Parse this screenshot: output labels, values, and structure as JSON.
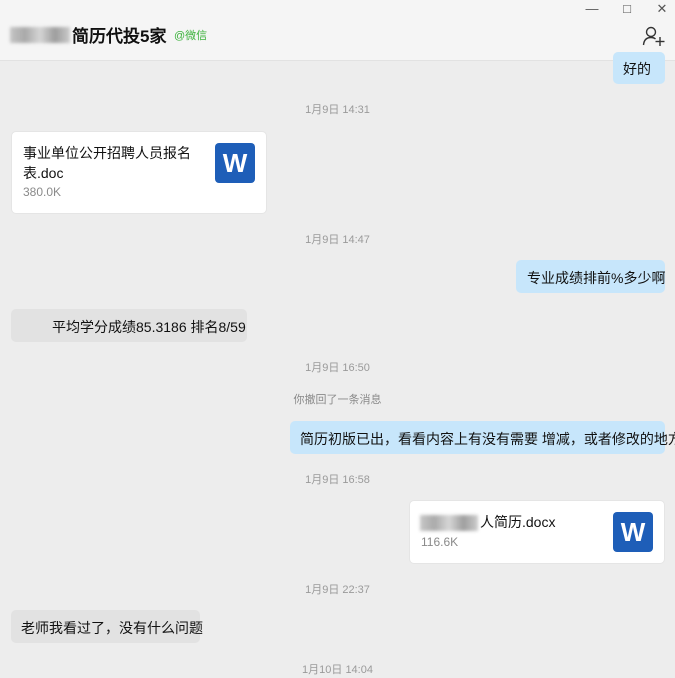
{
  "header": {
    "title": "简历代投5家",
    "source_tag": "@微信",
    "add_member_icon": "add-user-icon",
    "window_controls": [
      "minimize-icon",
      "maximize-icon",
      "close-icon"
    ]
  },
  "messages": {
    "m0_text": "好的",
    "t1": "1月9日 14:31",
    "file1": {
      "name_line1": "事业单位公开招聘人员报名",
      "name_line2": "表.doc",
      "size": "380.0K",
      "icon_letter": "W"
    },
    "t2": "1月9日 14:47",
    "m2_text": "专业成绩排前%多少啊",
    "m3_text": "平均学分成绩85.3186 排名8/59",
    "t3": "1月9日 16:50",
    "recall_notice": "你撤回了一条消息",
    "m4_text": "简历初版已出，看看内容上有没有需要 增减，或者修改的地方",
    "t4": "1月9日 16:58",
    "file2": {
      "name": "人简历.docx",
      "size": "116.6K",
      "icon_letter": "W"
    },
    "t5": "1月9日 22:37",
    "m5_text": "老师我看过了，没有什么问题",
    "t6": "1月10日 14:04"
  }
}
